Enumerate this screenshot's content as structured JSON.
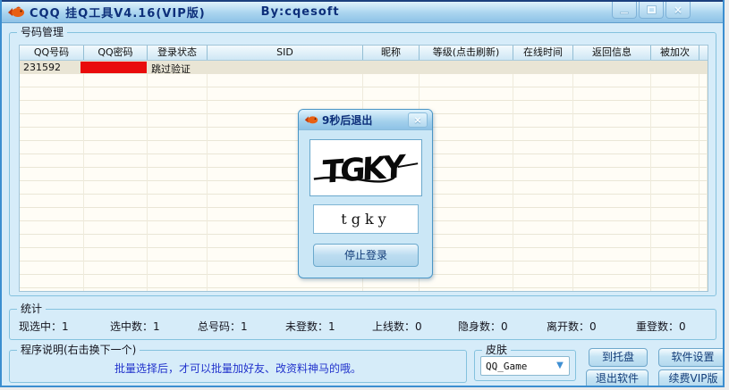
{
  "window": {
    "title": "CQQ 挂Q工具V4.16(VIP版)",
    "byline": "By:cqesoft"
  },
  "number_mgmt": {
    "label": "号码管理"
  },
  "table": {
    "columns": [
      "QQ号码",
      "QQ密码",
      "登录状态",
      "SID",
      "昵称",
      "等级(点击刷新)",
      "在线时间",
      "返回信息",
      "被加次"
    ],
    "row": {
      "qq_number": "231592",
      "password_redacted": true,
      "login_status": "跳过验证"
    }
  },
  "dialog": {
    "title": "9秒后退出",
    "captcha_text": "TGKY",
    "input_value": "tgky",
    "stop_button": "停止登录",
    "close_glyph": "×"
  },
  "stats": {
    "label": "统计",
    "items": [
      {
        "label": "现选中：",
        "value": "1"
      },
      {
        "label": "选中数：",
        "value": "1"
      },
      {
        "label": "总号码：",
        "value": "1"
      },
      {
        "label": "未登数：",
        "value": "1"
      },
      {
        "label": "上线数：",
        "value": "0"
      },
      {
        "label": "隐身数：",
        "value": "0"
      },
      {
        "label": "离开数：",
        "value": "0"
      },
      {
        "label": "重登数：",
        "value": "0"
      }
    ]
  },
  "description": {
    "label": "程序说明(右击换下一个)",
    "text": "批量选择后，才可以批量加好友、改资料神马的哦。"
  },
  "skin": {
    "label": "皮肤",
    "selected": "QQ_Game",
    "chevron": "▼"
  },
  "action_buttons": {
    "to_tray": "到托盘",
    "settings": "软件设置",
    "exit": "退出软件",
    "renew_vip": "续费VIP版"
  },
  "titlebar_buttons": {
    "close_glyph": "×"
  },
  "colors": {
    "body_bg": "#d6ecf9",
    "titlebar_text": "#0d2f7a",
    "frame_border": "#3b8ed0",
    "groupbox_border": "#84c2de",
    "selected_row_bg": "#e9e5d5",
    "redaction_red": "#e90c0c",
    "description_text": "#2233cc",
    "dialog_border": "#4a96c6"
  }
}
